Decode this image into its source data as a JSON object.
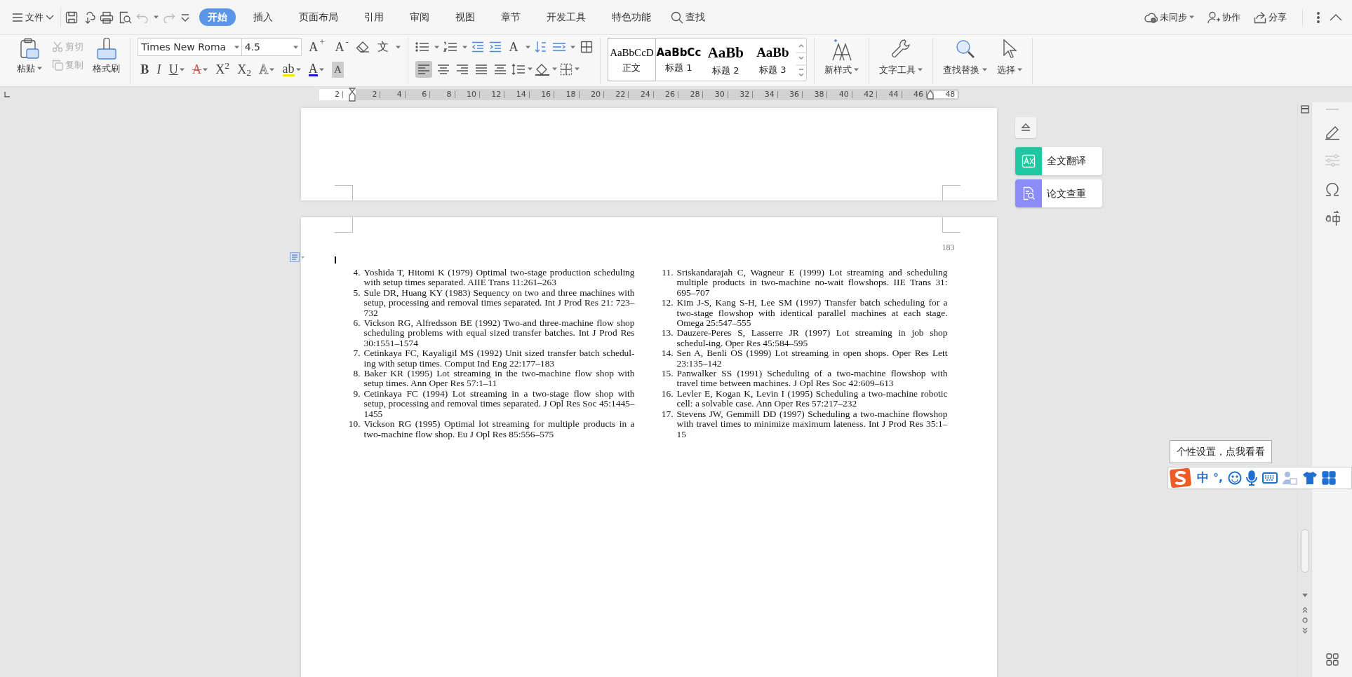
{
  "menu_bar": {
    "file_menu": "文件",
    "tabs": [
      {
        "label": "开始",
        "selected": true
      },
      {
        "label": "插入",
        "selected": false
      },
      {
        "label": "页面布局",
        "selected": false
      },
      {
        "label": "引用",
        "selected": false
      },
      {
        "label": "审阅",
        "selected": false
      },
      {
        "label": "视图",
        "selected": false
      },
      {
        "label": "章节",
        "selected": false
      },
      {
        "label": "开发工具",
        "selected": false
      },
      {
        "label": "特色功能",
        "selected": false
      }
    ],
    "search": "查找",
    "sync": "未同步",
    "collaborate": "协作",
    "share": "分享"
  },
  "ribbon": {
    "clipboard": [
      {
        "kind": "paste",
        "label": "粘贴",
        "disabled": false
      },
      {
        "kind": "cut",
        "label": "剪切",
        "disabled": true
      },
      {
        "kind": "copy",
        "label": "复制",
        "disabled": true
      },
      {
        "kind": "painter",
        "label": "格式刷",
        "disabled": false
      }
    ],
    "font_name": "Times New Roma",
    "font_size": "4.5",
    "font_tools": [
      {
        "kind": "grow",
        "glyph": "A$^{+}$"
      },
      {
        "kind": "shrink",
        "glyph": "A$^{-}$"
      },
      {
        "kind": "pinyin",
        "glyph": "文"
      }
    ],
    "format_buttons": [
      {
        "kind": "bold",
        "glyph": "B",
        "dropdown": false
      },
      {
        "kind": "italic",
        "glyph": "I",
        "dropdown": false
      },
      {
        "kind": "underline",
        "glyph": "U",
        "dropdown": true
      },
      {
        "kind": "strike",
        "glyph": "A",
        "dropdown": true
      },
      {
        "kind": "plain",
        "glyph": "X$^{2}$",
        "dropdown": false
      },
      {
        "kind": "plain",
        "glyph": "X$_{2}$",
        "dropdown": false
      },
      {
        "kind": "outline",
        "glyph": "A",
        "dropdown": true
      },
      {
        "kind": "highlight",
        "glyph": "ab",
        "dropdown": true
      },
      {
        "kind": "color",
        "glyph": "A",
        "dropdown": true
      },
      {
        "kind": "shade",
        "glyph": "A",
        "dropdown": false
      }
    ],
    "case_glyph": "A",
    "alignment": [
      {
        "selected": true
      },
      {
        "selected": false
      },
      {
        "selected": false
      },
      {
        "selected": false
      },
      {
        "selected": false
      }
    ],
    "styles": [
      {
        "preview": "AaBbCcD",
        "label": "正文",
        "selected": true,
        "kind": "body"
      },
      {
        "preview": "AaBbCc",
        "label": "标题 1",
        "selected": false,
        "kind": "h1"
      },
      {
        "preview": "AaBb",
        "label": "标题 2",
        "selected": false,
        "kind": "h2"
      },
      {
        "preview": "AaBb",
        "label": "标题 3",
        "selected": false,
        "kind": "h3"
      }
    ],
    "new_style": "新样式",
    "text_tools": "文字工具",
    "find_replace": "查找替换",
    "select": "选择"
  },
  "ruler": {
    "left_label": "2",
    "labels": [
      "2",
      "4",
      "6",
      "8",
      "10",
      "12",
      "14",
      "16",
      "18",
      "20",
      "22",
      "24",
      "26",
      "28",
      "30",
      "32",
      "34",
      "36",
      "38",
      "40",
      "42",
      "44",
      "46",
      "48"
    ]
  },
  "document": {
    "page_number": "183",
    "columns": [
      [
        {
          "number": "4.",
          "text": "Yoshida T, Hitomi K (1979) Optimal two-stage production scheduling with setup times separated. AIIE Trans 11:261–263"
        },
        {
          "number": "5.",
          "text": "Sule DR, Huang KY (1983) Sequency on two and three  machines with setup, processing and removal times separated. Int J Prod Res 21: 723–732"
        },
        {
          "number": "6.",
          "text": "Vickson RG, Alfredsson BE (1992) Two-and three-machine flow shop scheduling problems with equal sized transfer batches. Int J Prod Res 30:1551–1574"
        },
        {
          "number": "7.",
          "text": "Cetinkaya FC, Kayaligil MS (1992) Unit sized transfer batch schedul-ing with setup times. Comput Ind Eng 22:177–183"
        },
        {
          "number": "8.",
          "text": "Baker KR (1995) Lot streaming in the two-machine flow shop with setup times. Ann Oper Res 57:1–11"
        },
        {
          "number": "9.",
          "text": "Cetinkaya FC (1994) Lot streaming in a two-stage flow shop with setup, processing and removal times separated. J Opl Res Soc 45:1445–1455"
        },
        {
          "number": "10.",
          "text": "Vickson RG (1995) Optimal lot streaming for multiple products in a two-machine flow shop. Eu J Opl Res 85:556–575"
        }
      ],
      [
        {
          "number": "11.",
          "text": "Sriskandarajah C, Wagneur E (1999) Lot streaming and scheduling multiple products in two-machine no-wait flowshops. IIE Trans 31: 695–707"
        },
        {
          "number": "12.",
          "text": "Kim J-S, Kang  S-H, Lee SM (1997) Transfer batch scheduling  for a two-stage flowshop with identical parallel machines at each stage. Omega 25:547–555"
        },
        {
          "number": "13.",
          "text": "Dauzere-Peres S, Lasserre JR (1997) Lot streaming in job shop schedul-ing. Oper Res 45:584–595"
        },
        {
          "number": "14.",
          "text": "Sen A, Benli OS (1999) Lot streaming in open shops. Oper Res Lett 23:135–142"
        },
        {
          "number": "15.",
          "text": "Panwalker SS (1991) Scheduling of a two-machine flowshop with travel time between machines. J Opl Res Soc 42:609–613"
        },
        {
          "number": "16.",
          "text": "Levler E, Kogan K, Levin I (1995) Scheduling a two-machine robotic cell: a solvable case. Ann Oper Res 57:217–232"
        },
        {
          "number": "17.",
          "text": "Stevens JW, Gemmill DD (1997) Scheduling a two-machine flowshop with travel times to minimize maximum lateness. Int J Prod Res 35:1–15"
        }
      ]
    ]
  },
  "float_tools": [
    {
      "kind": "translate",
      "label": "全文翻译",
      "color": "#1ec8a0"
    },
    {
      "kind": "check",
      "label": "论文查重",
      "color": "#8a8cf8"
    }
  ],
  "ime": {
    "tooltip": "个性设置，点我看看",
    "mode": "中",
    "punctuation": "°,"
  }
}
